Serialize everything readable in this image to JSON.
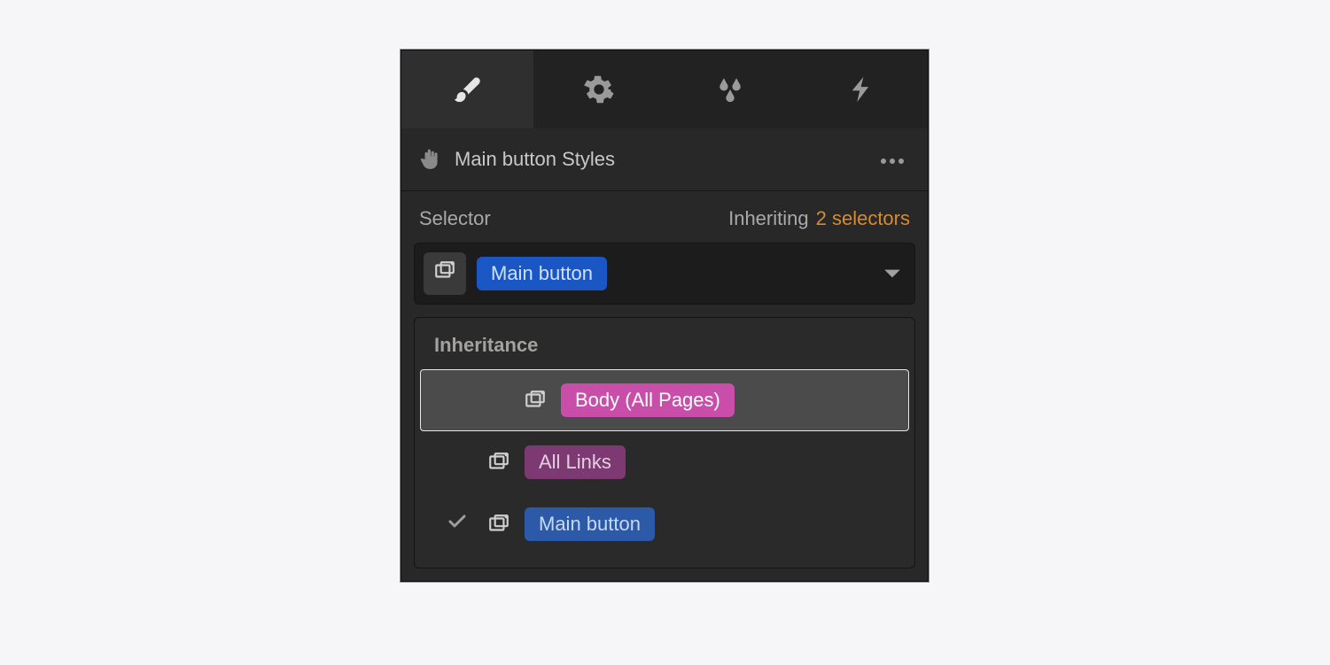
{
  "tabs": {
    "style": "Style",
    "settings": "Settings",
    "effects": "Effects",
    "interactions": "Interactions"
  },
  "title": "Main button Styles",
  "selector": {
    "label": "Selector",
    "inheriting_label": "Inheriting",
    "inheriting_count": "2 selectors",
    "current_chip": "Main button"
  },
  "inheritance": {
    "title": "Inheritance",
    "items": [
      {
        "label": "Body (All Pages)",
        "chip_class": "chip-pink-bright",
        "checked": false,
        "highlight": true
      },
      {
        "label": "All Links",
        "chip_class": "chip-pink-dim",
        "checked": false,
        "highlight": false
      },
      {
        "label": "Main button",
        "chip_class": "chip-blue-dim",
        "checked": true,
        "highlight": false
      }
    ]
  }
}
